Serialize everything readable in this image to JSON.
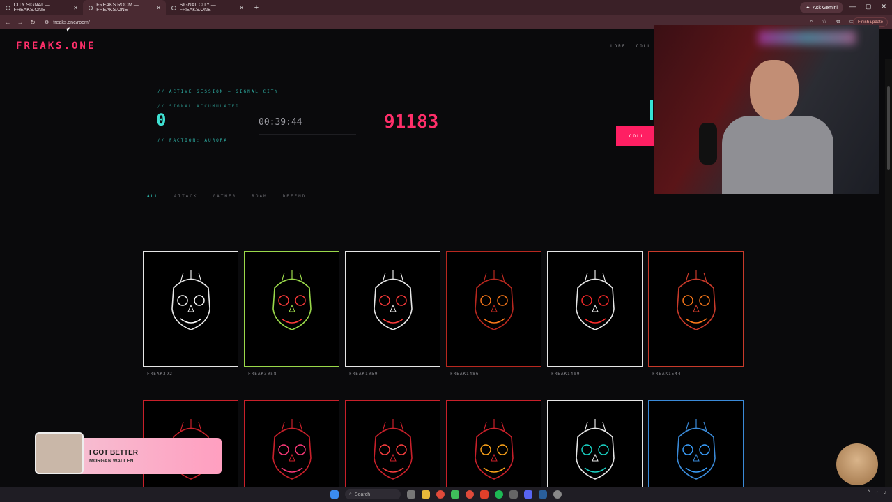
{
  "tabs": [
    {
      "label": "CITY SIGNAL — FREAKS.ONE"
    },
    {
      "label": "FREAKS ROOM — FREAKS.ONE"
    },
    {
      "label": "SIGNAL CITY — FREAKS.ONE"
    }
  ],
  "browser": {
    "url": "freaks.one/room/",
    "ask_gemini": "Ask Gemini",
    "update_label": "Finish update"
  },
  "site": {
    "logo": "FREAKS.ONE",
    "nav": [
      "LORE",
      "COLL"
    ]
  },
  "session": {
    "active_label": "// ACTIVE SESSION — SIGNAL CITY",
    "signal_label": "// SIGNAL ACCUMULATED",
    "signal_value": "0",
    "countdown": "00:39:44",
    "room_value": "91183",
    "faction_label": "// FACTION: AURORA",
    "collect_label": "COLL"
  },
  "filters": {
    "items": [
      "ALL",
      "ATTACK",
      "GATHER",
      "ROAM",
      "DEFEND"
    ]
  },
  "cards": [
    {
      "name": "FREAK392",
      "color": "#e6e6e6",
      "accent": "#ffffff"
    },
    {
      "name": "FREAK3058",
      "color": "#9ad84a",
      "accent": "#ff3b3b"
    },
    {
      "name": "FREAK1059",
      "color": "#e6e6e6",
      "accent": "#ff3b3b"
    },
    {
      "name": "FREAK1486",
      "color": "#b8281f",
      "accent": "#ff7a1a"
    },
    {
      "name": "FREAK1409",
      "color": "#e6e6e6",
      "accent": "#ff2a2a"
    },
    {
      "name": "FREAK1544",
      "color": "#c83a2a",
      "accent": "#ff7a1a"
    },
    {
      "name": "",
      "color": "#c8202a",
      "accent": "#ffffff"
    },
    {
      "name": "",
      "color": "#c8202a",
      "accent": "#ff3a7a"
    },
    {
      "name": "",
      "color": "#c8202a",
      "accent": "#ff4040"
    },
    {
      "name": "",
      "color": "#c8202a",
      "accent": "#ffa51a"
    },
    {
      "name": "",
      "color": "#e6e6e6",
      "accent": "#1ad6c8"
    },
    {
      "name": "",
      "color": "#3a8ad8",
      "accent": "#3aa0ff"
    }
  ],
  "music": {
    "title": "I GOT BETTER",
    "artist": "MORGAN WALLEN"
  },
  "taskbar": {
    "search": "Search"
  },
  "colors": {
    "brand": "#ff2f6a",
    "cyan": "#34d6c9",
    "chrome": "#3a2027"
  }
}
